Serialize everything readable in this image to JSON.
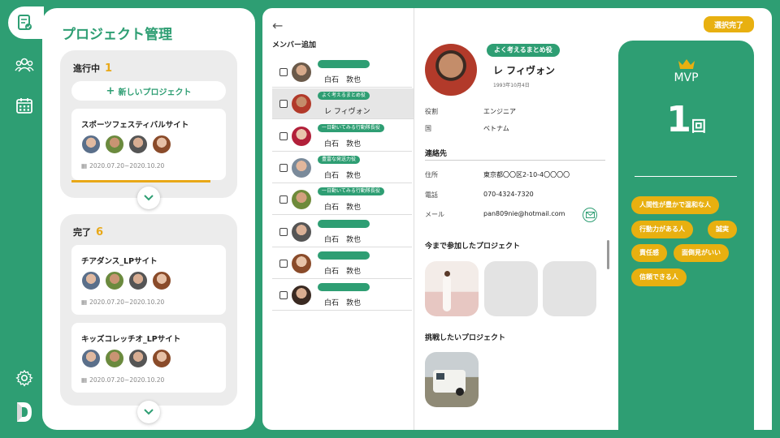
{
  "projects": {
    "title": "プロジェクト管理",
    "in_progress": {
      "label": "進行中",
      "count": "1",
      "new_button": "新しいプロジェクト",
      "cards": [
        {
          "title": "スポーツフェスティバルサイト",
          "date": "2020.07.20~2020.10.20",
          "progress": 0.9
        }
      ]
    },
    "completed": {
      "label": "完了",
      "count": "6",
      "cards": [
        {
          "title": "チアダンス_LPサイト",
          "date": "2020.07.20~2020.10.20"
        },
        {
          "title": "キッズコレッチオ_LPサイト",
          "date": "2020.07.20~2020.10.20"
        }
      ]
    }
  },
  "members": {
    "title": "メンバー追加",
    "rows": [
      {
        "tag": "",
        "name": "白石　敦也",
        "selected": false
      },
      {
        "tag": "よく考えるまとめ役",
        "name": "レ フィヴォン",
        "selected": true
      },
      {
        "tag": "一日動いてみる行動隊長役",
        "name": "白石　敦也",
        "selected": false
      },
      {
        "tag": "豊富な発送力役",
        "name": "白石　敦也",
        "selected": false
      },
      {
        "tag": "一日動いてみる行動隊長役",
        "name": "白石　敦也",
        "selected": false
      },
      {
        "tag": "",
        "name": "白石　敦也",
        "selected": false
      },
      {
        "tag": "",
        "name": "白石　敦也",
        "selected": false
      },
      {
        "tag": "",
        "name": "白石　敦也",
        "selected": false
      }
    ]
  },
  "profile": {
    "role_tag": "よく考えるまとめ役",
    "name": "レ フィヴォン",
    "birth": "1993年10月4日",
    "role_label": "役割",
    "role_value": "エンジニア",
    "country_label": "国",
    "country_value": "ベトナム",
    "contact_title": "連絡先",
    "address_label": "住所",
    "address_value": "東京都〇〇区2-10-4〇〇〇〇",
    "phone_label": "電話",
    "phone_value": "070-4324-7320",
    "mail_label": "メール",
    "mail_value": "pan809nie@hotmail.com",
    "joined_title": "今まで参加したプロジェクト",
    "challenge_title": "挑戦したいプロジェクト"
  },
  "mvp": {
    "done_button": "選択完了",
    "label": "MVP",
    "count": "1",
    "unit": "回",
    "traits": [
      "人間性が豊かで温和な人",
      "行動力がある人",
      "誠実",
      "責任感",
      "面倒見がいい",
      "信頼できる人"
    ]
  },
  "colors": {
    "green": "#2e9e73",
    "gold": "#e8b010"
  }
}
